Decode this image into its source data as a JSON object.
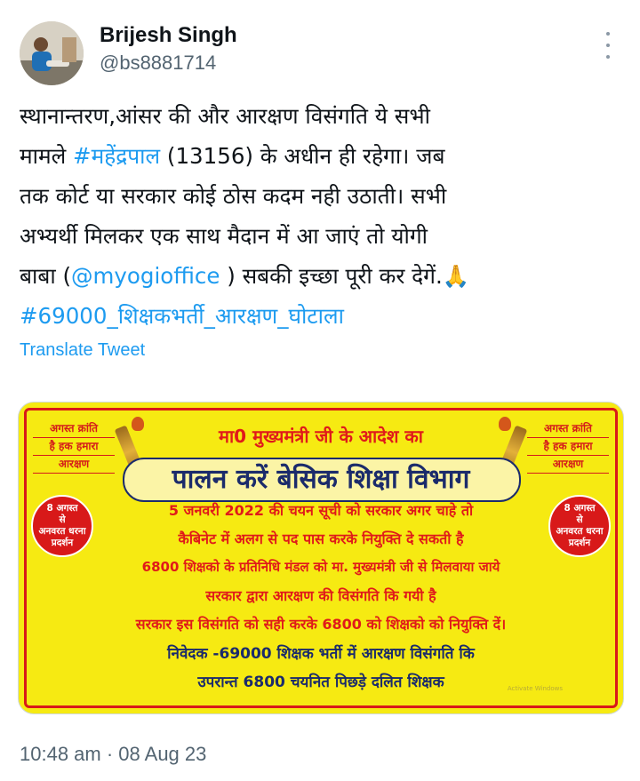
{
  "author": {
    "name": "Brijesh Singh",
    "handle": "@bs8881714"
  },
  "tweet": {
    "line1": "स्थानान्तरण,आंसर की और आरक्षण विसंगति ये सभी",
    "line2_pre": "मामले ",
    "line2_hashtag": "#महेंद्रपाल",
    "line2_post": " (13156) के अधीन ही रहेगा। जब",
    "line3": "तक कोर्ट या सरकार कोई ठोस कदम नही उठाती। सभी",
    "line4": "अभ्यर्थी मिलकर एक साथ मैदान में आ जाएं तो योगी",
    "line5_pre": "बाबा (",
    "line5_mention": "@myogioffice",
    "line5_post": " ) सबकी इच्छा पूरी कर देगें.",
    "emoji": "🙏",
    "hashtag2": "#69000_शिक्षकभर्ती_आरक्षण_घोटाला"
  },
  "translate_label": "Translate Tweet",
  "media": {
    "corner_left": [
      "अगस्त क्रांति",
      "है हक हमारा",
      "आरक्षण"
    ],
    "corner_right": [
      "अगस्त क्रांति",
      "है हक हमारा",
      "आरक्षण"
    ],
    "circle_left": [
      "8 अगस्त",
      "से",
      "अनवरत धरना",
      "प्रदर्शन"
    ],
    "circle_right": [
      "8 अगस्त",
      "से",
      "अनवरत धरना",
      "प्रदर्शन"
    ],
    "head1": "मा0 मुख्यमंत्री जी के आदेश का",
    "head2": "पालन करें बेसिक शिक्षा विभाग",
    "line1": "5 जनवरी 2022 की चयन सूची को सरकार अगर चाहे तो",
    "line2": "कैबिनेट में अलग से पद पास करके नियुक्ति दे सकती है",
    "line3": "6800 शिक्षको के प्रतिनिधि मंडल को मा. मुख्यमंत्री जी से मिलवाया जाये",
    "line4": "सरकार द्वारा आरक्षण की विसंगति कि गयी है",
    "line5": "सरकार इस विसंगति को सही करके 6800 को शिक्षको को नियुक्ति दें।",
    "line6": "निवेदक -69000 शिक्षक भर्ती में आरक्षण विसंगति कि",
    "line7": "उपरान्त 6800 चयनित पिछड़े दलित शिक्षक",
    "watermark": "Activate Windows",
    "colors": {
      "background": "#f6ea12",
      "red": "#e01a1a",
      "navy": "#1b2b6b"
    }
  },
  "timestamp": "10:48 am · 08 Aug 23"
}
